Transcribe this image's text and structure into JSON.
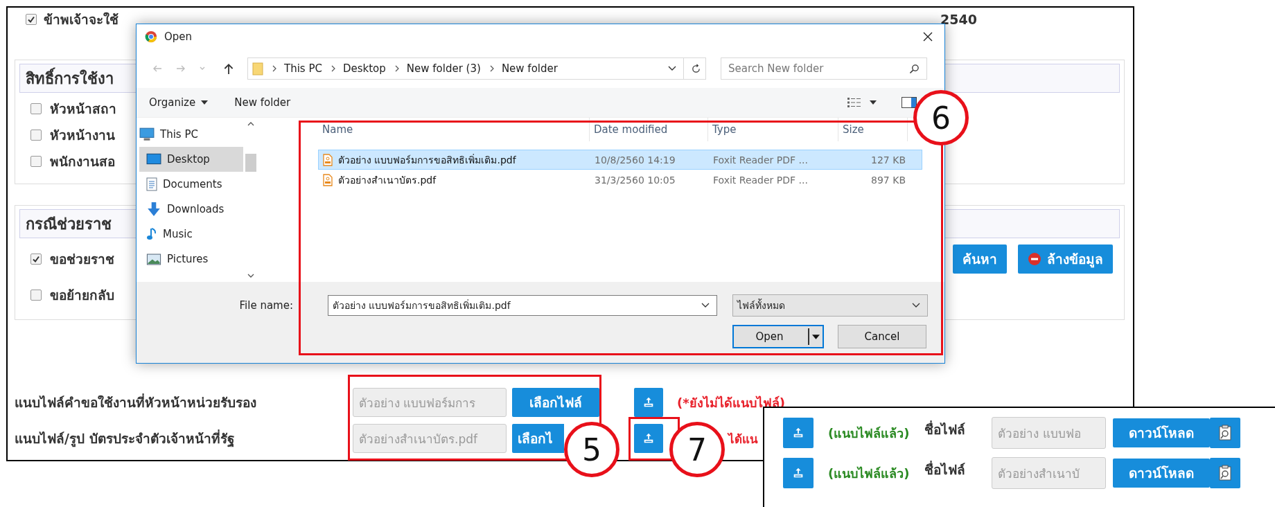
{
  "form": {
    "consent": {
      "checked": true,
      "text": "ข้าพเจ้าจะใช้",
      "text_end": "2540"
    },
    "sections": [
      {
        "title": "สิทธิ์การใช้งา",
        "options": [
          {
            "label": "หัวหน้าสถา",
            "checked": false
          },
          {
            "label": "หัวหน้างาน",
            "checked": false
          },
          {
            "label": "พนักงานสอ",
            "checked": false
          }
        ]
      },
      {
        "title": "กรณีช่วยราช",
        "options": [
          {
            "label": "ขอช่วยราช",
            "checked": true
          },
          {
            "label": "ขอย้ายกลับ",
            "checked": false
          }
        ],
        "buttons": [
          {
            "kind": "search",
            "label": "ค้นหา"
          },
          {
            "kind": "clear",
            "label": "ล้างข้อมูล"
          }
        ]
      }
    ],
    "attachments": [
      {
        "label": "แนบไฟล์คำขอใช้งานที่หัวหน้าหน่วยรับรอง",
        "file_name": "ตัวอย่าง แบบฟอร์มการ",
        "choose_button": "เลือกไฟล์",
        "attached": false,
        "status": "(*ยังไม่ได้แนบไฟล์)"
      },
      {
        "label": "แนบไฟล์/รูป บัตรประจำตัวเจ้าหน้าที่รัฐ",
        "file_name": "ตัวอย่างสำเนาบัตร.pdf",
        "choose_button": "เลือกไ",
        "attached": false,
        "status": "ได้แน"
      }
    ]
  },
  "file_dialog": {
    "title": "Open",
    "path": [
      "This PC",
      "Desktop",
      "New folder (3)",
      "New folder"
    ],
    "search_placeholder": "Search New folder",
    "toolbar": [
      "Organize",
      "New folder"
    ],
    "nav_tree": [
      {
        "label": "This PC",
        "kind": "pc",
        "selected": false,
        "children": [
          {
            "label": "Desktop",
            "kind": "desktop",
            "selected": true
          },
          {
            "label": "Documents",
            "kind": "documents",
            "selected": false
          },
          {
            "label": "Downloads",
            "kind": "downloads",
            "selected": false
          },
          {
            "label": "Music",
            "kind": "music",
            "selected": false
          },
          {
            "label": "Pictures",
            "kind": "pictures",
            "selected": false
          }
        ]
      }
    ],
    "columns": [
      "Name",
      "Date modified",
      "Type",
      "Size"
    ],
    "files": [
      {
        "name": "ตัวอย่าง แบบฟอร์มการขอสิทธิเพิ่มเติม.pdf",
        "modified": "10/8/2560 14:19",
        "type": "Foxit Reader PDF ...",
        "size": "127 KB",
        "selected": true
      },
      {
        "name": "ตัวอย่างสำเนาบัตร.pdf",
        "modified": "31/3/2560 10:05",
        "type": "Foxit Reader PDF ...",
        "size": "897 KB",
        "selected": false
      }
    ],
    "file_name_label": "File name:",
    "file_name": "ตัวอย่าง แบบฟอร์มการขอสิทธิเพิ่มเติม.pdf",
    "file_type": "ไฟล์ทั้งหมด",
    "buttons": [
      "Open",
      "Cancel"
    ]
  },
  "inset": {
    "rows": [
      {
        "attached": true,
        "status": "(แนบไฟล์แล้ว)",
        "name_label": "ชื่อไฟล์",
        "file_name": "ตัวอย่าง แบบฟอ",
        "download_button": "ดาวน์โหลด"
      },
      {
        "attached": true,
        "status": "(แนบไฟล์แล้ว)",
        "name_label": "ชื่อไฟล์",
        "file_name": "ตัวอย่างสำเนาบั",
        "download_button": "ดาวน์โหลด"
      }
    ]
  },
  "callouts": [
    {
      "number": "5"
    },
    {
      "number": "6"
    },
    {
      "number": "7"
    }
  ]
}
